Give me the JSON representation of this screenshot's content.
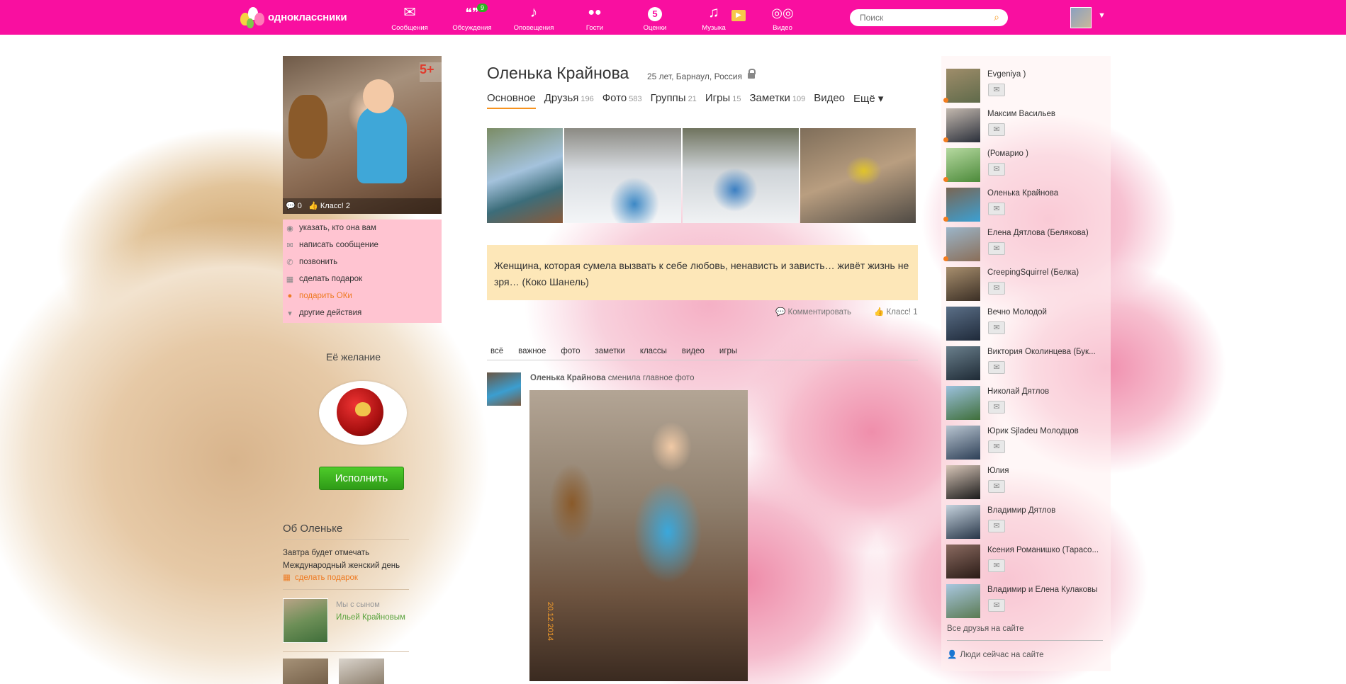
{
  "app": {
    "brand": "одноклассники",
    "accent": "#f90fa0"
  },
  "nav": [
    {
      "label": "Сообщения",
      "icon": "envelope-icon",
      "glyph": "✉"
    },
    {
      "label": "Обсуждения",
      "icon": "discussions-icon",
      "glyph": "💬",
      "badge": "9"
    },
    {
      "label": "Оповещения",
      "icon": "bell-icon",
      "glyph": "🔔"
    },
    {
      "label": "Гости",
      "icon": "footprints-icon",
      "glyph": "👣"
    },
    {
      "label": "Оценки",
      "icon": "ratings-icon",
      "glyph": "5"
    },
    {
      "label": "Музыка",
      "icon": "music-icon",
      "glyph": "♫"
    },
    {
      "label": "Видео",
      "icon": "video-icon",
      "glyph": "▶"
    }
  ],
  "search": {
    "placeholder": "Поиск"
  },
  "profile": {
    "name": "Оленька Крайнова",
    "meta": "25 лет, Барнаул, Россия",
    "avatar_badge": "5+",
    "avatar_comments": "0",
    "avatar_class": "Класс! 2"
  },
  "tabs": [
    {
      "label": "Основное",
      "count": ""
    },
    {
      "label": "Друзья",
      "count": "196"
    },
    {
      "label": "Фото",
      "count": "583"
    },
    {
      "label": "Группы",
      "count": "21"
    },
    {
      "label": "Игры",
      "count": "15"
    },
    {
      "label": "Заметки",
      "count": "109"
    },
    {
      "label": "Видео",
      "count": ""
    },
    {
      "label": "Ещё ▾",
      "count": ""
    }
  ],
  "actions": [
    {
      "label": "указать, кто она вам",
      "icon": "pin-icon",
      "glyph": "◉"
    },
    {
      "label": "написать сообщение",
      "icon": "envelope-icon",
      "glyph": "✉"
    },
    {
      "label": "позвонить",
      "icon": "phone-icon",
      "glyph": "✆"
    },
    {
      "label": "сделать подарок",
      "icon": "gift-icon",
      "glyph": "▦"
    },
    {
      "label": "подарить ОКи",
      "icon": "ok-coin-icon",
      "glyph": "●"
    },
    {
      "label": "другие действия",
      "icon": "chevron-down-icon",
      "glyph": "▾"
    }
  ],
  "wish": {
    "title": "Её желание",
    "button": "Исполнить"
  },
  "about": {
    "title": "Об Оленьке",
    "text_line1": "Завтра будет отмечать",
    "text_line2": "Международный женский день",
    "gift_link": "сделать подарок",
    "relation_label": "Мы с сыном",
    "relation_name": "Ильей Крайновым"
  },
  "status": {
    "text": "Женщина, которая сумела вызвать к себе любовь, ненависть и зависть… живёт жизнь не зря… (Коко Шанель)",
    "comment_label": "Комментировать",
    "class_label": "Класс! 1"
  },
  "feed_filters": [
    "всё",
    "важное",
    "фото",
    "заметки",
    "классы",
    "видео",
    "игры"
  ],
  "feed": {
    "author": "Оленька Крайнова",
    "action": "сменила главное фото",
    "photo_date": "20.12.2014"
  },
  "friends": [
    {
      "name": "Evgeniya )",
      "online": true
    },
    {
      "name": "Максим Васильев",
      "online": true
    },
    {
      "name": "(Ромарио )",
      "online": true
    },
    {
      "name": "Оленька Крайнова",
      "online": true
    },
    {
      "name": "Елена Дятлова (Белякова)",
      "online": true
    },
    {
      "name": "CreepingSquirrel (Белка)",
      "online": false
    },
    {
      "name": "Вечно Молодой",
      "online": false
    },
    {
      "name": "Виктория Околинцева (Бук...",
      "online": false
    },
    {
      "name": "Николай Дятлов",
      "online": false
    },
    {
      "name": "Юрик Sjladeu Молодцов",
      "online": false
    },
    {
      "name": "Юлия",
      "online": false
    },
    {
      "name": "Владимир Дятлов",
      "online": false
    },
    {
      "name": "Ксения Романишко (Тарасо...",
      "online": false
    },
    {
      "name": "Владимир и Елена Кулаковы",
      "online": false
    }
  ],
  "friends_footer": {
    "all_online": "Все друзья на сайте",
    "people_now": "Люди сейчас на сайте"
  }
}
